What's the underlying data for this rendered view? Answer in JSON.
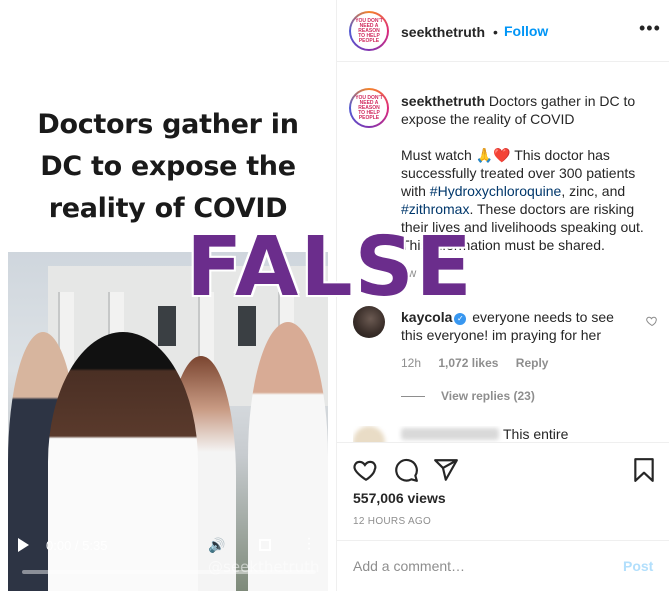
{
  "video": {
    "title_lines": [
      "Doctors gather in",
      "DC to expose the",
      "reality of COVID"
    ],
    "time": "0:00 / 5:35",
    "watermark": "@seekthetruth",
    "progress_fraction": 0.0
  },
  "post": {
    "avatar_text": "YOU DON'T NEED A REASON TO HELP PEOPLE",
    "username": "seekthetruth",
    "separator": "•",
    "follow_label": "Follow",
    "more_icon": "more-horizontal-icon",
    "caption": {
      "username": "seekthetruth",
      "headline": "Doctors gather in DC to expose the reality of COVID",
      "body_1": "Must watch 🙏❤️ This doctor has successfully treated over 300 patients with ",
      "tag_1": "#Hydroxychloroquine",
      "body_2": ", zinc, and ",
      "tag_2": "#zithromax",
      "body_3": ". These doctors are risking their lives and livelihoods speaking out. This information must be shared."
    },
    "caption_time": "2w"
  },
  "comment": {
    "username": "kaycola",
    "text": "everyone needs to see this everyone! im praying for her",
    "time": "12h",
    "likes": "1,072 likes",
    "reply_label": "Reply",
    "view_replies": "View replies (23)"
  },
  "next_comment": {
    "text": "This entire"
  },
  "actions": {
    "views": "557,006 views",
    "posted": "12 HOURS AGO",
    "comment_placeholder": "Add a comment…",
    "post_label": "Post"
  },
  "overlay": {
    "verdict": "FALSE"
  },
  "colors": {
    "link_blue": "#0095f6",
    "verdict_purple": "#6b2d8c",
    "meta_gray": "#8e8e8e"
  }
}
